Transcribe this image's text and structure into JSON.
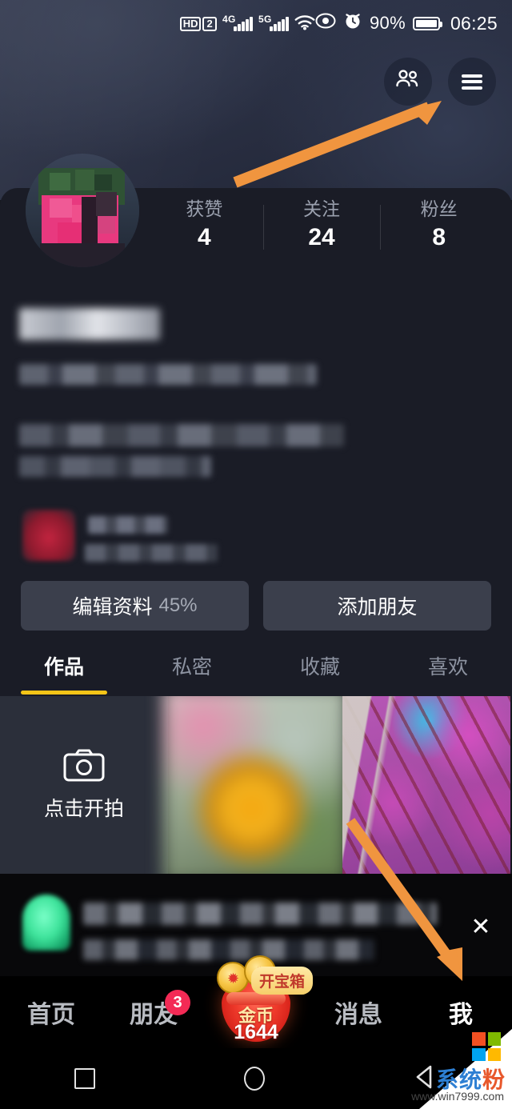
{
  "statusbar": {
    "hd_label": "HD",
    "hd_sub": "2",
    "sim1_gen": "4G",
    "sim2_gen": "5G",
    "battery_percent": "90%",
    "time": "06:25",
    "icons": [
      "hd-icon",
      "signal-icon",
      "signal-icon",
      "wifi-icon",
      "eye-icon",
      "alarm-icon",
      "battery-icon"
    ]
  },
  "header": {
    "friends_button_label": "friends-icon",
    "menu_button_label": "hamburger-menu-icon"
  },
  "profile": {
    "stats": [
      {
        "label": "获赞",
        "value": "4"
      },
      {
        "label": "关注",
        "value": "24"
      },
      {
        "label": "粉丝",
        "value": "8"
      }
    ],
    "nickname": "",
    "bio_lines": [
      "",
      "",
      ""
    ],
    "card": {
      "title": "",
      "subtitle": ""
    }
  },
  "actions": {
    "edit_profile_label": "编辑资料",
    "edit_profile_percent": "45%",
    "add_friend_label": "添加朋友"
  },
  "tabs": [
    {
      "label": "作品",
      "active": true
    },
    {
      "label": "私密",
      "active": false
    },
    {
      "label": "收藏",
      "active": false
    },
    {
      "label": "喜欢",
      "active": false
    }
  ],
  "grid": {
    "shoot_label": "点击开拍",
    "shoot_icon": "camera-icon",
    "items": [
      "yellow-rose-thumbnail",
      "purple-blossom-tree-thumbnail"
    ]
  },
  "promo": {
    "text_line1": "",
    "text_line2": "",
    "close_label": "✕"
  },
  "bottomnav": {
    "items": [
      {
        "label": "首页",
        "active": false,
        "badge": ""
      },
      {
        "label": "朋友",
        "active": false,
        "badge": "3"
      },
      {
        "label": "消息",
        "active": false,
        "badge": ""
      },
      {
        "label": "我",
        "active": true,
        "badge": ""
      }
    ],
    "coin": {
      "label": "金币",
      "amount": "1644",
      "pill_label": "开宝箱"
    }
  },
  "androidnav": {
    "recents": "square-recents-icon",
    "home": "circle-home-icon",
    "back": "triangle-back-icon"
  },
  "watermark": {
    "title_blue": "系统",
    "title_orange": "粉",
    "url": "www.win7999.com"
  },
  "colors": {
    "accent_yellow": "#f5c518",
    "badge_red": "#f32a55",
    "arrow_orange": "#f0953f",
    "background": "#1a1c26",
    "nav_background": "#000000"
  }
}
